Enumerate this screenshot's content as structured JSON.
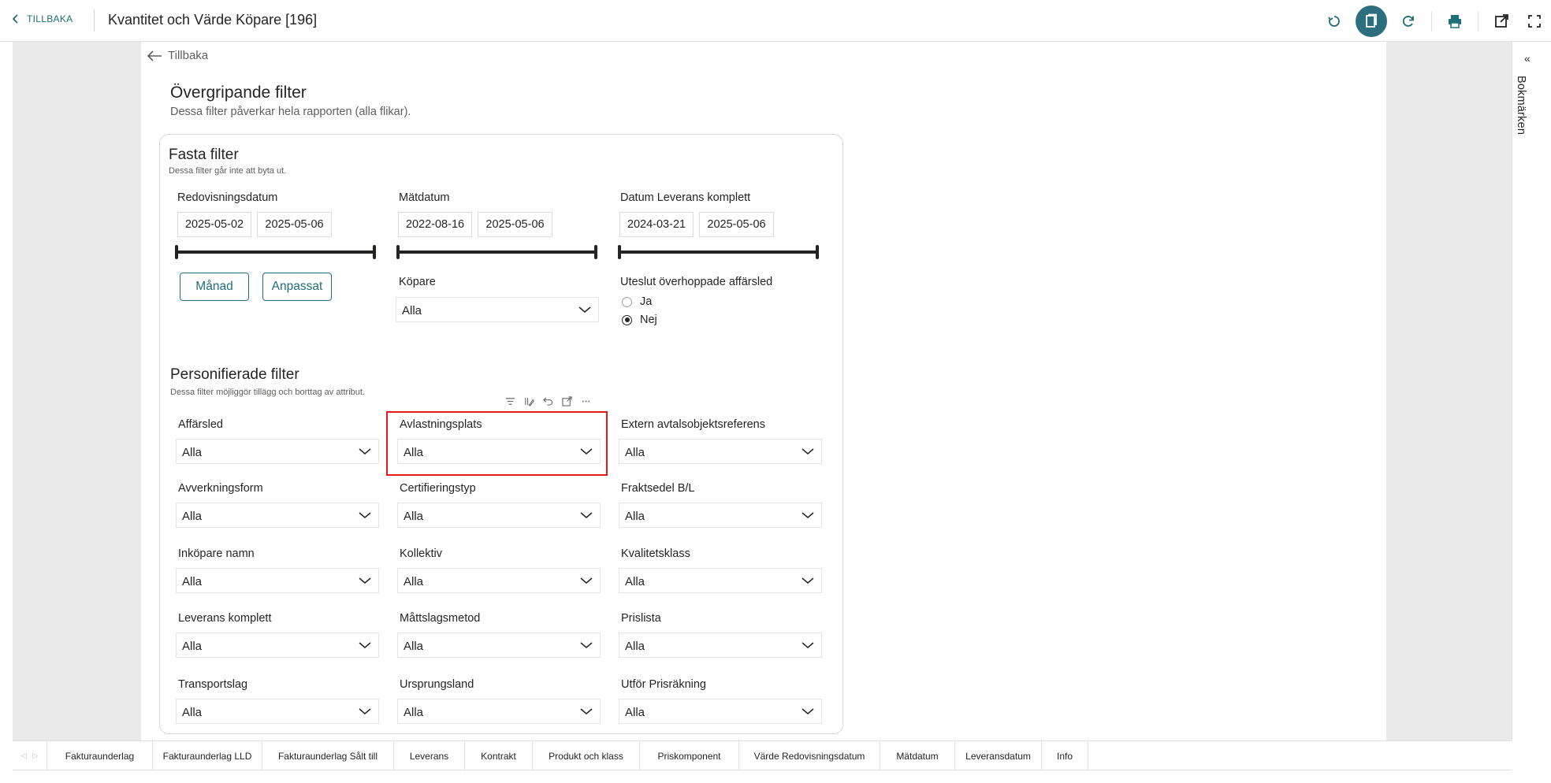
{
  "topbar": {
    "back_label": "TILLBAKA",
    "title": "Kvantitet och Värde Köpare [196]",
    "icons": [
      "reset-icon",
      "bookmark-icon",
      "refresh-icon",
      "print-icon",
      "open-external-icon",
      "fullscreen-icon"
    ]
  },
  "inner_back_label": "Tillbaka",
  "overgripande": {
    "title": "Övergripande filter",
    "subtitle": "Dessa filter påverkar hela rapporten (alla flikar)."
  },
  "fasta": {
    "title": "Fasta filter",
    "subtitle": "Dessa filter går inte att byta ut.",
    "redovisningsdatum": {
      "label": "Redovisningsdatum",
      "from": "2025-05-02",
      "to": "2025-05-06"
    },
    "matdatum": {
      "label": "Mätdatum",
      "from": "2022-08-16",
      "to": "2025-05-06"
    },
    "leverans_komplett": {
      "label": "Datum Leverans komplett",
      "from": "2024-03-21",
      "to": "2025-05-06"
    },
    "btn_manad": "Månad",
    "btn_anpassat": "Anpassat",
    "kopare": {
      "label": "Köpare",
      "value": "Alla"
    },
    "uteslut": {
      "label": "Uteslut överhoppade affärsled",
      "options": [
        "Ja",
        "Nej"
      ],
      "selected": "Nej"
    }
  },
  "personifierade": {
    "title": "Personifierade filter",
    "subtitle": "Dessa filter möjliggör tillägg och borttag av attribut.",
    "toolbar_icons": [
      "filter-icon",
      "format-icon",
      "undo-icon",
      "focus-mode-icon",
      "more-options-icon"
    ],
    "filters": [
      {
        "label": "Affärsled",
        "value": "Alla"
      },
      {
        "label": "Avlastningsplats",
        "value": "Alla"
      },
      {
        "label": "Extern avtalsobjektsreferens",
        "value": "Alla"
      },
      {
        "label": "Avverkningsform",
        "value": "Alla"
      },
      {
        "label": "Certifieringstyp",
        "value": "Alla"
      },
      {
        "label": "Fraktsedel B/L",
        "value": "Alla"
      },
      {
        "label": "Inköpare namn",
        "value": "Alla"
      },
      {
        "label": "Kollektiv",
        "value": "Alla"
      },
      {
        "label": "Kvalitetsklass",
        "value": "Alla"
      },
      {
        "label": "Leverans komplett",
        "value": "Alla"
      },
      {
        "label": "Måttslagsmetod",
        "value": "Alla"
      },
      {
        "label": "Prislista",
        "value": "Alla"
      },
      {
        "label": "Transportslag",
        "value": "Alla"
      },
      {
        "label": "Ursprungsland",
        "value": "Alla"
      },
      {
        "label": "Utför Prisräkning",
        "value": "Alla"
      }
    ]
  },
  "bookmarks": {
    "label": "Bokmärken",
    "collapse_glyph": "«"
  },
  "tabs": [
    "Fakturaunderlag",
    "Fakturaunderlag LLD",
    "Fakturaunderlag Sålt till",
    "Leverans",
    "Kontrakt",
    "Produkt och klass",
    "Priskomponent",
    "Värde Redovisningsdatum",
    "Mätdatum",
    "Leveransdatum",
    "Info"
  ],
  "colors": {
    "accent": "#1e6e7a",
    "active_icon_bg": "#2d6e7e",
    "highlight": "#e3191d",
    "canvas": "#eaeaea"
  }
}
